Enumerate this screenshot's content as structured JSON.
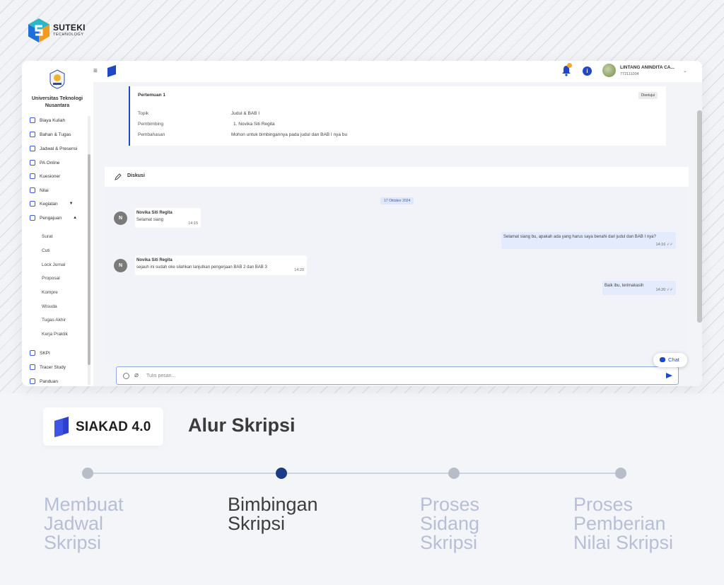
{
  "brand": {
    "name": "SUTEKI",
    "sub": "TECHNOLOGY"
  },
  "sidebar": {
    "university": "Universitas Teknologi Nusantara",
    "items": [
      {
        "label": "Biaya Kuliah",
        "icon": "bill-icon"
      },
      {
        "label": "Bahan & Tugas",
        "icon": "bookmark-icon"
      },
      {
        "label": "Jadwal & Presensi",
        "icon": "calendar-icon"
      },
      {
        "label": "PA Online",
        "icon": "video-icon"
      },
      {
        "label": "Kuesioner",
        "icon": "checklist-icon"
      },
      {
        "label": "Nilai",
        "icon": "star-icon"
      },
      {
        "label": "Kegiatan",
        "icon": "folder-icon"
      },
      {
        "label": "Pengajuan",
        "icon": "document-icon"
      }
    ],
    "sub_items": [
      "Surat",
      "Cuti",
      "Lock Jurnal",
      "Proposal",
      "Kompre",
      "Wisuda",
      "Tugas Akhir",
      "Kerja Praktik"
    ],
    "bottom_items": [
      {
        "label": "SKPI",
        "icon": "document-icon"
      },
      {
        "label": "Tracer Study",
        "icon": "graduation-icon"
      },
      {
        "label": "Panduan",
        "icon": "help-icon"
      }
    ]
  },
  "topbar": {
    "user_name": "LINTANG ANINDITA CA...",
    "user_id": "772111004",
    "info_label": "i"
  },
  "meeting": {
    "title": "Pertemuan 1",
    "status": "Disetujui",
    "rows": [
      {
        "label": "Topik",
        "value": "Judul & BAB I"
      },
      {
        "label": "Pembimbing",
        "value": "1. Novika Siti Regita"
      },
      {
        "label": "Pembahasan",
        "value": "Mohon untuk bimbingannya pada judul dan BAB I nya bu"
      }
    ]
  },
  "discussion": {
    "title": "Diskusi",
    "date": "17 Oktober 2024",
    "messages": [
      {
        "sender": "Novika Siti Regita",
        "initial": "N",
        "text": "Selamat siang",
        "time": "14:15"
      },
      {
        "text": "Selamat siang bu, apakah ada yang harus saya benahi dari judul dan BAB I nya?",
        "time": "14:16 ✓✓"
      },
      {
        "sender": "Novika Siti Regita",
        "initial": "N",
        "text": "sejauh ini sudah oke silahkan lanjutkan pengerjaan BAB 2 dan BAB 3",
        "time": "14:20"
      },
      {
        "text": "Baik ibu, terimakasih",
        "time": "14:20 ✓✓"
      }
    ],
    "input_placeholder": "Tulis pesan...",
    "chat_button": "Chat"
  },
  "product": {
    "name": "SIAKAD 4.0",
    "section_title": "Alur Skripsi"
  },
  "timeline": {
    "active_index": 1,
    "steps": [
      {
        "line1": "Membuat",
        "line2": "Jadwal",
        "line3": "Skripsi"
      },
      {
        "line1": "Bimbingan",
        "line2": "Skripsi",
        "line3": ""
      },
      {
        "line1": "Proses",
        "line2": "Sidang",
        "line3": "Skripsi"
      },
      {
        "line1": "Proses",
        "line2": "Pemberian",
        "line3": "Nilai Skripsi"
      }
    ]
  },
  "colors": {
    "accent": "#2046c9",
    "timeline_active": "#1a3d85",
    "timeline_inactive": "#b8bdca"
  }
}
